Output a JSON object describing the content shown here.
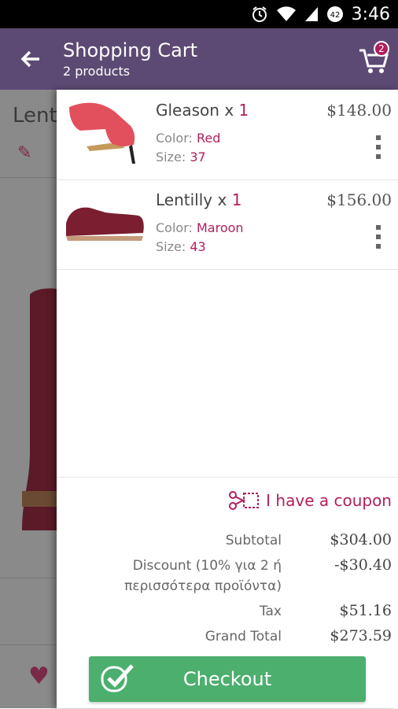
{
  "status_bar": {
    "time": "3:46",
    "battery_level": "42"
  },
  "app_bar": {
    "title": "Shopping Cart",
    "subtitle": "2 products",
    "cart_badge": "2"
  },
  "background_page": {
    "title": "Lenti"
  },
  "cart": {
    "items": [
      {
        "name": "Gleason",
        "qty_prefix": "x",
        "qty": "1",
        "price": "$148.00",
        "color_label": "Color:",
        "color": "Red",
        "size_label": "Size:",
        "size": "37"
      },
      {
        "name": "Lentilly",
        "qty_prefix": "x",
        "qty": "1",
        "price": "$156.00",
        "color_label": "Color:",
        "color": "Maroon",
        "size_label": "Size:",
        "size": "43"
      }
    ],
    "coupon_label": "I have a coupon",
    "subtotal_label": "Subtotal",
    "subtotal": "$304.00",
    "discount_label_1": "Discount (10% για 2 ή",
    "discount_label_2": "περισσότερα προϊόντα)",
    "discount": "-$30.40",
    "tax_label": "Tax",
    "tax": "$51.16",
    "grand_total_label": "Grand Total",
    "grand_total": "$273.59",
    "checkout_label": "Checkout"
  },
  "colors": {
    "app_bar": "#5d4a74",
    "accent": "#b01f5d",
    "checkout": "#4caf6e"
  }
}
